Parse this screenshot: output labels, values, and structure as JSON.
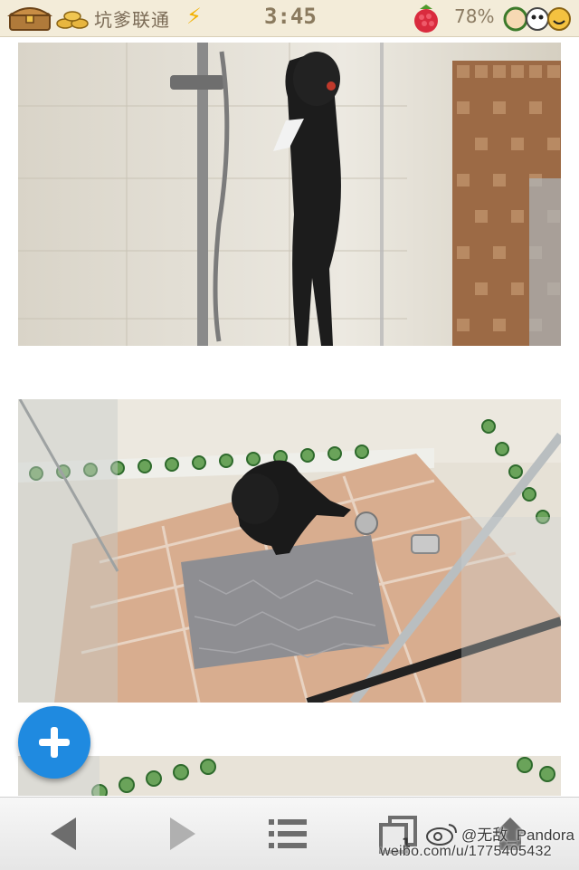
{
  "status_bar": {
    "carrier": "坑爹联通",
    "bolt": "⚡",
    "time": "3:45",
    "battery": "78%"
  },
  "content": {
    "photos": [
      {
        "icon": "photo-dog-hanging-shower"
      },
      {
        "icon": "photo-dog-shower-floor"
      },
      {
        "icon": "photo-shower-wall-partial"
      }
    ]
  },
  "fab": {
    "icon": "plus-icon",
    "color": "#1f8ae0"
  },
  "toolbar": {
    "tab_count": "1",
    "icons": [
      "back-arrow-icon",
      "forward-arrow-icon",
      "menu-list-icon",
      "tabs-icon",
      "home-icon"
    ]
  },
  "watermark": {
    "user": "@无敌_Pandora",
    "url": "weibo.com/u/1775405432"
  },
  "colors": {
    "status_bar_bg": "#f3ecd9",
    "toolbar_bg": "#ececec",
    "accent": "#1f8ae0"
  }
}
